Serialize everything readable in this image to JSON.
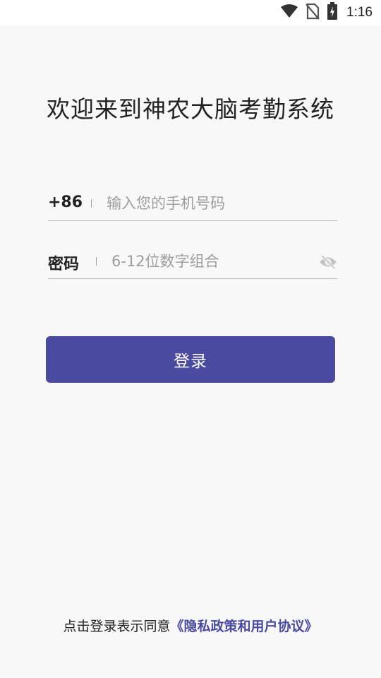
{
  "status_bar": {
    "time": "1:16",
    "icons": [
      "wifi-icon",
      "no-sim-icon",
      "battery-charging-icon"
    ]
  },
  "title": "欢迎来到神农大脑考勤系统",
  "phone_field": {
    "prefix": "+86",
    "value": "",
    "placeholder": "输入您的手机号码"
  },
  "password_field": {
    "label": "密码",
    "value": "",
    "placeholder": "6-12位数字组合",
    "visibility_icon": "eye-off-icon"
  },
  "login_button": {
    "label": "登录",
    "color": "#4a4aa0"
  },
  "agreement": {
    "prefix": "点击登录表示同意",
    "link": "《隐私政策和用户协议》",
    "link_color": "#4a4aa0"
  }
}
